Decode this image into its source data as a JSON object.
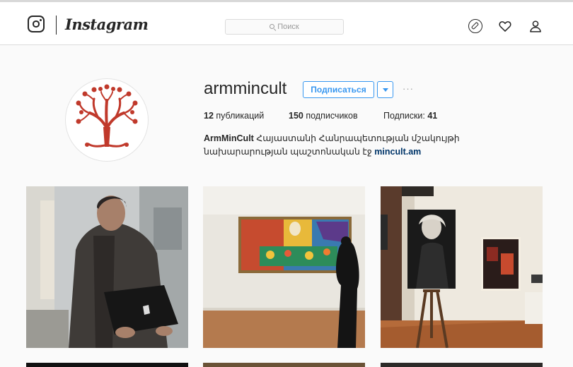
{
  "header": {
    "wordmark": "Instagram",
    "search_placeholder": "Поиск",
    "icons": [
      "instagram-logo-icon",
      "compass-icon",
      "heart-icon",
      "person-icon"
    ]
  },
  "profile": {
    "username": "armmincult",
    "follow_label": "Подписаться",
    "more_label": "···",
    "stats": {
      "posts_count": "12",
      "posts_label": " публикаций",
      "followers_count": "150",
      "followers_label": " подписчиков",
      "following_label": "Подписки: ",
      "following_count": "41"
    },
    "bio": {
      "name": "ArmMinCult",
      "text": " Հայաստանի Հանրապետության մշակույթի նախարարության պաշտոնական էջ ",
      "link": "mincult.am"
    }
  },
  "colors": {
    "accent": "#3897f0",
    "logo_red": "#c0392b",
    "link": "#003569"
  },
  "posts": [
    {
      "name": "man-with-laptop-photo"
    },
    {
      "name": "gallery-painting-photo"
    },
    {
      "name": "exhibition-easel-photo"
    }
  ]
}
